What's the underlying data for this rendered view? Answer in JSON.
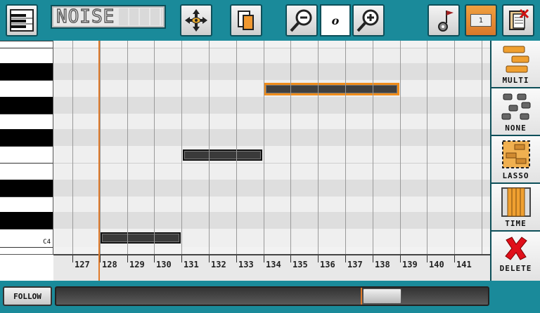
{
  "toolbar": {
    "instrument_name": "NOISE",
    "note_value": "o",
    "channel_number": "1",
    "icons": [
      "piano-icon",
      "move-arrows-icon",
      "copy-icon",
      "zoom-out-icon",
      "zoom-in-icon",
      "note-settings-icon",
      "channel-icon",
      "clipboard-delete-icon"
    ]
  },
  "keyboard": {
    "c4_label": "C4"
  },
  "ruler": {
    "labels": [
      "127",
      "128",
      "129",
      "130",
      "131",
      "132",
      "133",
      "134",
      "135",
      "136",
      "137",
      "138",
      "139",
      "140",
      "141"
    ]
  },
  "tools": {
    "multi_label": "MULTI",
    "none_label": "NONE",
    "lasso_label": "LASSO",
    "time_label": "TIME",
    "delete_label": "DELETE"
  },
  "bottom": {
    "follow_label": "FOLLOW",
    "scroll_position": 0.78
  },
  "colors": {
    "background": "#1a8a9a",
    "accent": "#f08c1a",
    "note": "#3a3a3a",
    "delete": "#e0101a"
  }
}
